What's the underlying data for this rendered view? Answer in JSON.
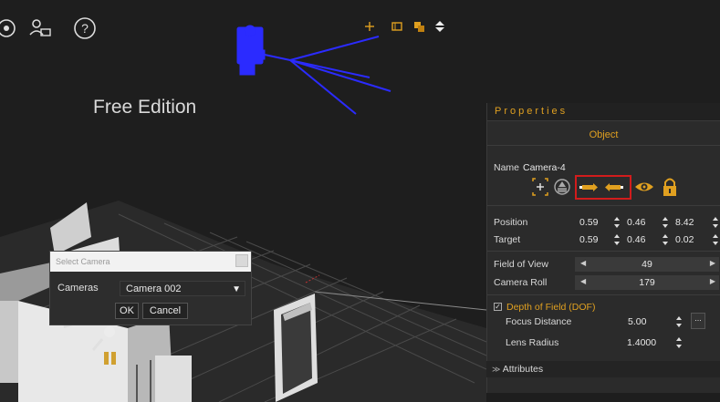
{
  "viewport": {
    "watermark": "Free Edition",
    "top_icons": [
      "camera-icon",
      "user-monitor-icon",
      "help-icon"
    ],
    "mini_tools": [
      "move-icon",
      "frame-icon",
      "layers-icon",
      "up-down-arrows-icon"
    ]
  },
  "select_camera": {
    "title": "Select Camera",
    "cameras_label": "Cameras",
    "selected_camera": "Camera 002",
    "ok_label": "OK",
    "cancel_label": "Cancel"
  },
  "properties": {
    "title": "Properties",
    "tab": "Object",
    "name_label": "Name",
    "name_value": "Camera-4",
    "toolbar_icons": [
      "move-target-icon",
      "rotate-icon",
      "set-position-icon",
      "set-target-icon",
      "visibility-eye-icon",
      "lock-icon"
    ],
    "position": {
      "label": "Position",
      "x": "0.59",
      "y": "0.46",
      "z": "8.42"
    },
    "target": {
      "label": "Target",
      "x": "0.59",
      "y": "0.46",
      "z": "0.02"
    },
    "field_of_view": {
      "label": "Field of View",
      "value": "49"
    },
    "camera_roll": {
      "label": "Camera Roll",
      "value": "179"
    },
    "dof": {
      "label": "Depth of Field (DOF)",
      "checked": true,
      "focus_distance_label": "Focus Distance",
      "focus_distance": "5.00",
      "focus_button": "...",
      "lens_radius_label": "Lens Radius",
      "lens_radius": "1.4000"
    },
    "attributes_label": "Attributes"
  },
  "colors": {
    "accent": "#e0a020",
    "highlight": "#d21c1c",
    "camera_model": "#2b2bff"
  }
}
